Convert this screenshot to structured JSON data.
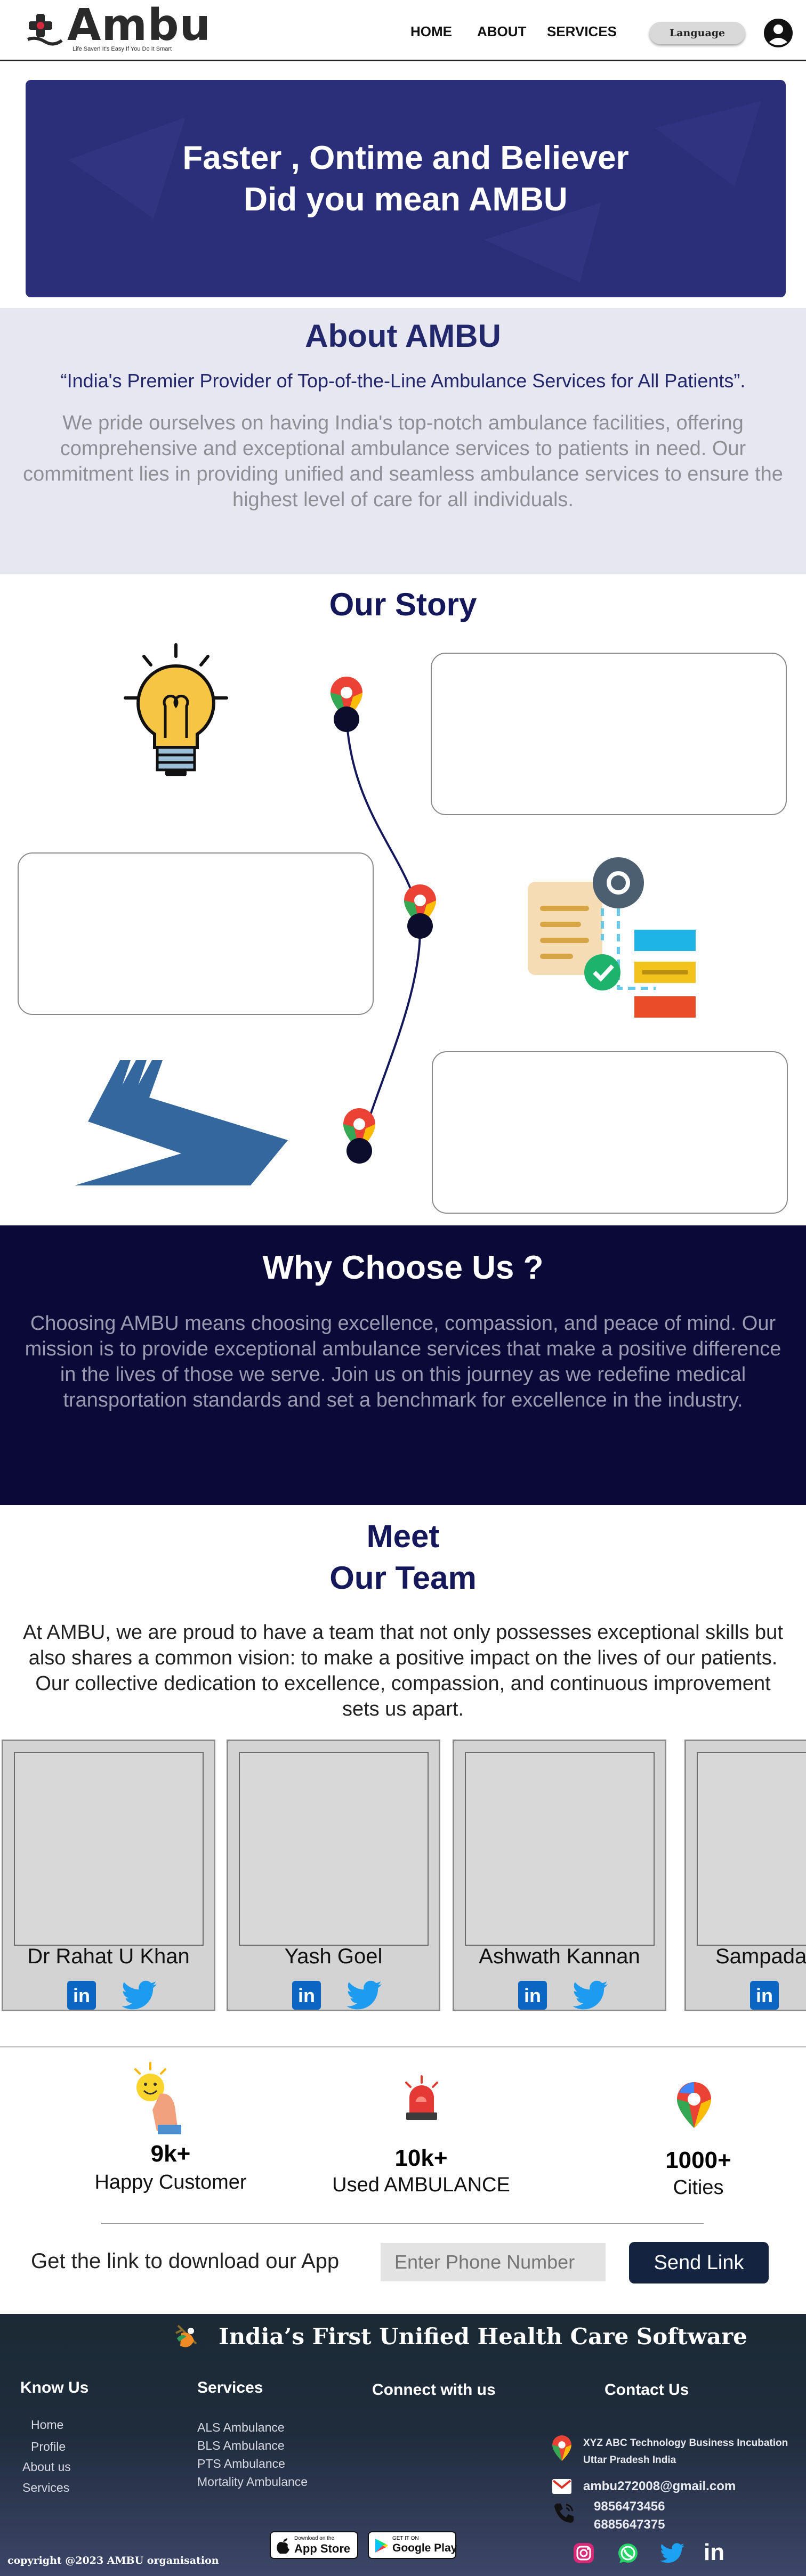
{
  "header": {
    "logo_text": "Ambu",
    "tagline": "Life Saver! It's Easy If You Do It Smart",
    "nav": {
      "home": "HOME",
      "about": "ABOUT",
      "services": "SERVICES"
    },
    "language_label": "Language",
    "icons": {
      "logo": "ambulance-cross-icon",
      "user": "user-circle-icon"
    }
  },
  "hero": {
    "line1": "Faster , Ontime and Believer",
    "line2": "Did you mean AMBU"
  },
  "about": {
    "title": "About  AMBU",
    "subtitle": "“India's Premier Provider of Top-of-the-Line Ambulance Services for All Patients”.",
    "body": "We pride ourselves on having India's top-notch ambulance facilities, offering comprehensive and exceptional ambulance services to patients in need. Our commitment lies in providing unified and seamless ambulance services to ensure the highest level of care for all individuals."
  },
  "story": {
    "title": "Our Story",
    "icons": [
      "lightbulb-icon",
      "location-pin-icon",
      "workflow-gear-icon",
      "road-icon"
    ]
  },
  "why": {
    "title": "Why Choose Us ?",
    "body": "Choosing AMBU means choosing excellence, compassion, and peace of mind. Our mission is to provide exceptional ambulance services that make a positive difference in the lives of those we serve. Join us on this journey as we redefine medical transportation standards and set a benchmark for excellence in the industry."
  },
  "team": {
    "title_line1": "Meet",
    "title_line2": "Our Team",
    "body": "At AMBU, we are proud to have a team that not only possesses exceptional skills but also shares a common vision: to make a positive impact on the lives of our patients. Our collective dedication to excellence, compassion, and continuous improvement sets us apart.",
    "members": [
      {
        "name": "Dr Rahat U Khan"
      },
      {
        "name": "Yash Goel"
      },
      {
        "name": "Ashwath Kannan"
      },
      {
        "name": "Sampada"
      }
    ],
    "linkedin_glyph": "in"
  },
  "stats": [
    {
      "value": "9k+",
      "label": "Happy Customer",
      "icon": "happy-emoji-icon"
    },
    {
      "value": "10k+",
      "label": "Used AMBULANCE",
      "icon": "siren-icon"
    },
    {
      "value": "1000+",
      "label": "Cities",
      "icon": "location-pin-icon"
    }
  ],
  "app": {
    "prompt": "Get the link to download our App",
    "placeholder": "Enter Phone Number",
    "button": "Send Link"
  },
  "footer": {
    "headline": "India’s First Unified Health Care Software",
    "know_us": {
      "title": "Know Us",
      "items": [
        "Home",
        "Profile",
        "About us",
        "Services"
      ]
    },
    "services": {
      "title": "Services",
      "items": [
        "ALS Ambulance",
        "BLS Ambulance",
        "PTS Ambulance",
        "Mortality Ambulance"
      ]
    },
    "connect": {
      "title": "Connect with us"
    },
    "contact": {
      "title": "Contact Us",
      "address_line1": "XYZ ABC Technology Business Incubation",
      "address_line2": "Uttar Pradesh India",
      "email": "ambu272008@gmail.com",
      "phone1": "9856473456",
      "phone2": "6885647375"
    },
    "stores": {
      "apple_small": "Download on the",
      "apple_big": "App Store",
      "google_small": "GET IT ON",
      "google_big": "Google Play"
    },
    "copyright": "copyright @2023 AMBU organisation",
    "colors": {
      "instagram": "#d62976",
      "whatsapp": "#25d366",
      "twitter": "#1da1f2",
      "linkedin": "#ffffff"
    }
  },
  "colors": {
    "brand": "#2b2e79",
    "dark_navy": "#0b0938",
    "accent_red": "#d4283c",
    "twitter": "#1d9bf0",
    "linkedin": "#0a66c2"
  }
}
